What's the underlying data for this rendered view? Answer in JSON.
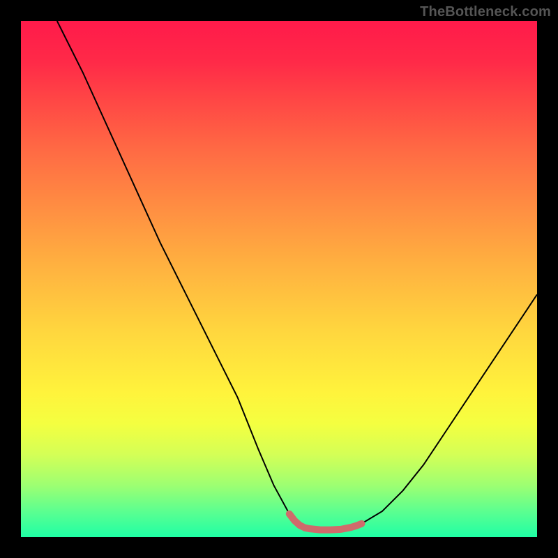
{
  "watermark": "TheBottleneck.com",
  "chart_data": {
    "type": "line",
    "title": "",
    "xlabel": "",
    "ylabel": "",
    "xlim": [
      0,
      100
    ],
    "ylim": [
      0,
      100
    ],
    "series": [
      {
        "name": "bottleneck-curve",
        "stroke": "#000000",
        "stroke_width": 2,
        "x": [
          7,
          12,
          17,
          22,
          27,
          32,
          37,
          42,
          46,
          49,
          52,
          54,
          56,
          58,
          60,
          62,
          64,
          66,
          70,
          74,
          78,
          82,
          86,
          90,
          94,
          98,
          100
        ],
        "y": [
          100,
          90,
          79,
          68,
          57,
          47,
          37,
          27,
          17,
          10,
          4.5,
          2.3,
          1.6,
          1.4,
          1.4,
          1.5,
          1.9,
          2.6,
          5,
          9,
          14,
          20,
          26,
          32,
          38,
          44,
          47
        ]
      },
      {
        "name": "optimal-zone",
        "stroke": "#cf6b6b",
        "stroke_width": 10,
        "linecap": "round",
        "x": [
          52,
          53,
          54,
          55,
          56,
          57,
          58,
          59,
          60,
          61,
          62,
          63,
          64,
          65,
          66
        ],
        "y": [
          4.5,
          3.2,
          2.3,
          1.8,
          1.6,
          1.5,
          1.4,
          1.4,
          1.4,
          1.45,
          1.5,
          1.7,
          1.9,
          2.2,
          2.6
        ]
      }
    ],
    "background": {
      "type": "vertical-gradient",
      "stops": [
        {
          "pos": 0.0,
          "color": "#ff1a4a"
        },
        {
          "pos": 0.5,
          "color": "#ffb040"
        },
        {
          "pos": 0.75,
          "color": "#fff33c"
        },
        {
          "pos": 1.0,
          "color": "#1fffa5"
        }
      ]
    }
  }
}
